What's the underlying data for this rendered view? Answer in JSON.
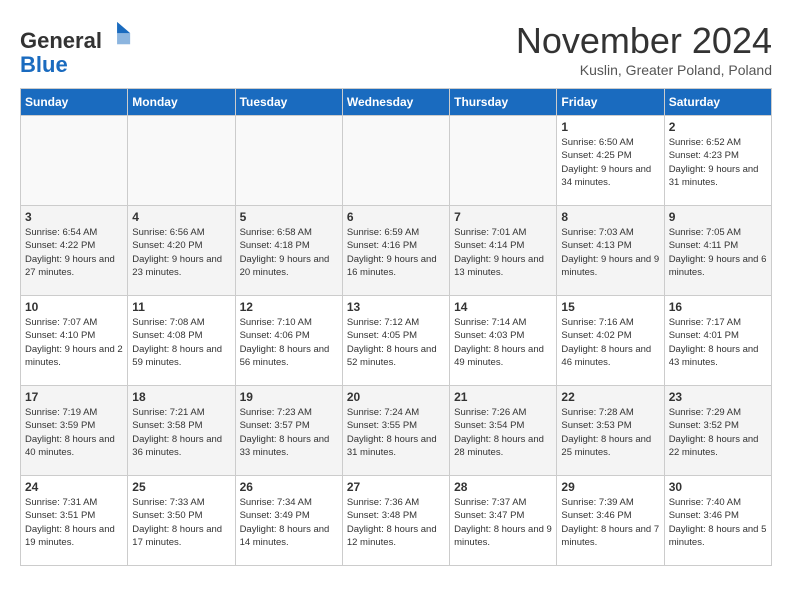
{
  "header": {
    "logo_general": "General",
    "logo_blue": "Blue",
    "month_title": "November 2024",
    "location": "Kuslin, Greater Poland, Poland"
  },
  "days_of_week": [
    "Sunday",
    "Monday",
    "Tuesday",
    "Wednesday",
    "Thursday",
    "Friday",
    "Saturday"
  ],
  "weeks": [
    [
      {
        "day": "",
        "info": ""
      },
      {
        "day": "",
        "info": ""
      },
      {
        "day": "",
        "info": ""
      },
      {
        "day": "",
        "info": ""
      },
      {
        "day": "",
        "info": ""
      },
      {
        "day": "1",
        "info": "Sunrise: 6:50 AM\nSunset: 4:25 PM\nDaylight: 9 hours and 34 minutes."
      },
      {
        "day": "2",
        "info": "Sunrise: 6:52 AM\nSunset: 4:23 PM\nDaylight: 9 hours and 31 minutes."
      }
    ],
    [
      {
        "day": "3",
        "info": "Sunrise: 6:54 AM\nSunset: 4:22 PM\nDaylight: 9 hours and 27 minutes."
      },
      {
        "day": "4",
        "info": "Sunrise: 6:56 AM\nSunset: 4:20 PM\nDaylight: 9 hours and 23 minutes."
      },
      {
        "day": "5",
        "info": "Sunrise: 6:58 AM\nSunset: 4:18 PM\nDaylight: 9 hours and 20 minutes."
      },
      {
        "day": "6",
        "info": "Sunrise: 6:59 AM\nSunset: 4:16 PM\nDaylight: 9 hours and 16 minutes."
      },
      {
        "day": "7",
        "info": "Sunrise: 7:01 AM\nSunset: 4:14 PM\nDaylight: 9 hours and 13 minutes."
      },
      {
        "day": "8",
        "info": "Sunrise: 7:03 AM\nSunset: 4:13 PM\nDaylight: 9 hours and 9 minutes."
      },
      {
        "day": "9",
        "info": "Sunrise: 7:05 AM\nSunset: 4:11 PM\nDaylight: 9 hours and 6 minutes."
      }
    ],
    [
      {
        "day": "10",
        "info": "Sunrise: 7:07 AM\nSunset: 4:10 PM\nDaylight: 9 hours and 2 minutes."
      },
      {
        "day": "11",
        "info": "Sunrise: 7:08 AM\nSunset: 4:08 PM\nDaylight: 8 hours and 59 minutes."
      },
      {
        "day": "12",
        "info": "Sunrise: 7:10 AM\nSunset: 4:06 PM\nDaylight: 8 hours and 56 minutes."
      },
      {
        "day": "13",
        "info": "Sunrise: 7:12 AM\nSunset: 4:05 PM\nDaylight: 8 hours and 52 minutes."
      },
      {
        "day": "14",
        "info": "Sunrise: 7:14 AM\nSunset: 4:03 PM\nDaylight: 8 hours and 49 minutes."
      },
      {
        "day": "15",
        "info": "Sunrise: 7:16 AM\nSunset: 4:02 PM\nDaylight: 8 hours and 46 minutes."
      },
      {
        "day": "16",
        "info": "Sunrise: 7:17 AM\nSunset: 4:01 PM\nDaylight: 8 hours and 43 minutes."
      }
    ],
    [
      {
        "day": "17",
        "info": "Sunrise: 7:19 AM\nSunset: 3:59 PM\nDaylight: 8 hours and 40 minutes."
      },
      {
        "day": "18",
        "info": "Sunrise: 7:21 AM\nSunset: 3:58 PM\nDaylight: 8 hours and 36 minutes."
      },
      {
        "day": "19",
        "info": "Sunrise: 7:23 AM\nSunset: 3:57 PM\nDaylight: 8 hours and 33 minutes."
      },
      {
        "day": "20",
        "info": "Sunrise: 7:24 AM\nSunset: 3:55 PM\nDaylight: 8 hours and 31 minutes."
      },
      {
        "day": "21",
        "info": "Sunrise: 7:26 AM\nSunset: 3:54 PM\nDaylight: 8 hours and 28 minutes."
      },
      {
        "day": "22",
        "info": "Sunrise: 7:28 AM\nSunset: 3:53 PM\nDaylight: 8 hours and 25 minutes."
      },
      {
        "day": "23",
        "info": "Sunrise: 7:29 AM\nSunset: 3:52 PM\nDaylight: 8 hours and 22 minutes."
      }
    ],
    [
      {
        "day": "24",
        "info": "Sunrise: 7:31 AM\nSunset: 3:51 PM\nDaylight: 8 hours and 19 minutes."
      },
      {
        "day": "25",
        "info": "Sunrise: 7:33 AM\nSunset: 3:50 PM\nDaylight: 8 hours and 17 minutes."
      },
      {
        "day": "26",
        "info": "Sunrise: 7:34 AM\nSunset: 3:49 PM\nDaylight: 8 hours and 14 minutes."
      },
      {
        "day": "27",
        "info": "Sunrise: 7:36 AM\nSunset: 3:48 PM\nDaylight: 8 hours and 12 minutes."
      },
      {
        "day": "28",
        "info": "Sunrise: 7:37 AM\nSunset: 3:47 PM\nDaylight: 8 hours and 9 minutes."
      },
      {
        "day": "29",
        "info": "Sunrise: 7:39 AM\nSunset: 3:46 PM\nDaylight: 8 hours and 7 minutes."
      },
      {
        "day": "30",
        "info": "Sunrise: 7:40 AM\nSunset: 3:46 PM\nDaylight: 8 hours and 5 minutes."
      }
    ]
  ]
}
